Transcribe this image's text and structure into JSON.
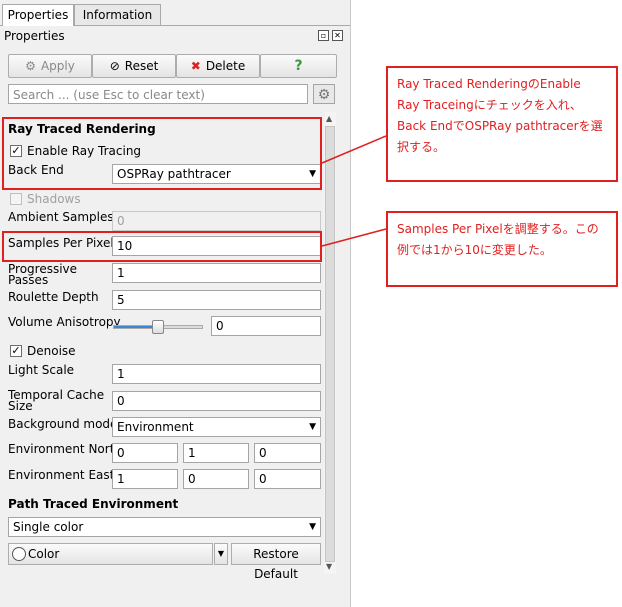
{
  "tabs": {
    "properties": "Properties",
    "information": "Information"
  },
  "panel_title": "Properties",
  "toolbar": {
    "apply": "Apply",
    "reset": "Reset",
    "delete": "Delete",
    "help": "?"
  },
  "search": {
    "placeholder": "Search ... (use Esc to clear text)"
  },
  "ray_traced": {
    "section": "Ray Traced Rendering",
    "enable_label": "Enable Ray Tracing",
    "enable_checked": true,
    "back_end_label": "Back End",
    "back_end_value": "OSPRay pathtracer",
    "shadows_label": "Shadows",
    "shadows_checked": false,
    "ambient_label": "Ambient Samples",
    "ambient_value": "0",
    "spp_label": "Samples Per Pixel",
    "spp_value": "10",
    "progressive_label_1": "Progressive",
    "progressive_label_2": "Passes",
    "progressive_value": "1",
    "roulette_label": "Roulette Depth",
    "roulette_value": "5",
    "anisotropy_label": "Volume Anisotropy",
    "anisotropy_value": "0",
    "anisotropy_slider_fraction": 0.5,
    "denoise_label": "Denoise",
    "denoise_checked": true,
    "light_scale_label": "Light Scale",
    "light_scale_value": "1",
    "temporal_label_1": "Temporal Cache",
    "temporal_label_2": "Size",
    "temporal_value": "0",
    "bg_mode_label": "Background mode",
    "bg_mode_value": "Environment",
    "env_north_label": "Environment North",
    "env_north": [
      "0",
      "1",
      "0"
    ],
    "env_east_label": "Environment East",
    "env_east": [
      "1",
      "0",
      "0"
    ]
  },
  "path_traced": {
    "section": "Path Traced Environment",
    "mode_value": "Single color",
    "color_label": "Color",
    "restore_label": "Restore Default"
  },
  "callouts": {
    "first": "Ray Traced RenderingのEnable Ray Traceingにチェックを入れ、Back EndでOSPRay pathtracerを選択する。",
    "second": "Samples Per Pixelを調整する。この例では1から10に変更した。"
  },
  "colors": {
    "annotation": "#e02020",
    "slider_fill": "#3c86d6"
  }
}
